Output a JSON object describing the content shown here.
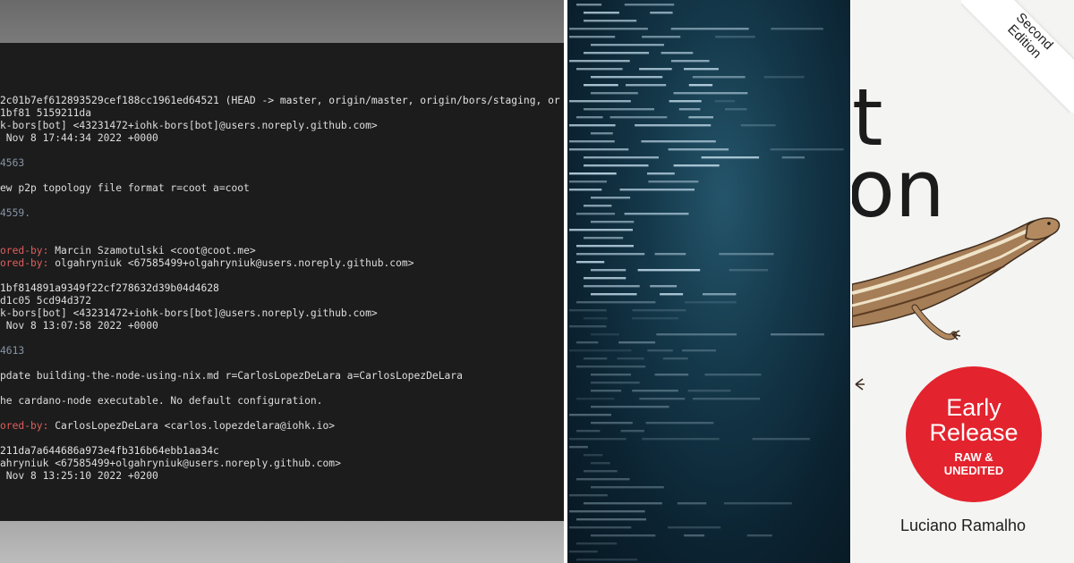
{
  "terminal": {
    "lines": [
      {
        "text": "2c01b7ef612893529cef188cc1961ed64521 (HEAD -> master, origin/master, origin/bors/staging, or",
        "style": "commit"
      },
      {
        "text": "1bf81 5159211da",
        "style": "normal"
      },
      {
        "text": "k-bors[bot] <43231472+iohk-bors[bot]@users.noreply.github.com>",
        "style": "normal"
      },
      {
        "text": " Nov 8 17:44:34 2022 +0000",
        "style": "normal"
      },
      {
        "text": "",
        "style": "normal"
      },
      {
        "text": "4563",
        "style": "dim"
      },
      {
        "text": "",
        "style": "normal"
      },
      {
        "text": "ew p2p topology file format r=coot a=coot",
        "style": "normal"
      },
      {
        "text": "",
        "style": "normal"
      },
      {
        "text": "4559.",
        "style": "dim"
      },
      {
        "text": "",
        "style": "normal"
      },
      {
        "text": "",
        "style": "normal"
      },
      {
        "text": "ored-by:",
        "style": "co",
        "rest": " Marcin Szamotulski <coot@coot.me>"
      },
      {
        "text": "ored-by:",
        "style": "co",
        "rest": " olgahryniuk <67585499+olgahryniuk@users.noreply.github.com>"
      },
      {
        "text": "",
        "style": "normal"
      },
      {
        "text": "1bf814891a9349f22cf278632d39b04d4628",
        "style": "commit"
      },
      {
        "text": "d1c05 5cd94d372",
        "style": "normal"
      },
      {
        "text": "k-bors[bot] <43231472+iohk-bors[bot]@users.noreply.github.com>",
        "style": "normal"
      },
      {
        "text": " Nov 8 13:07:58 2022 +0000",
        "style": "normal"
      },
      {
        "text": "",
        "style": "normal"
      },
      {
        "text": "4613",
        "style": "dim"
      },
      {
        "text": "",
        "style": "normal"
      },
      {
        "text": "pdate building-the-node-using-nix.md r=CarlosLopezDeLara a=CarlosLopezDeLara",
        "style": "normal"
      },
      {
        "text": "",
        "style": "normal"
      },
      {
        "text": "he cardano-node executable. No default configuration.",
        "style": "normal"
      },
      {
        "text": "",
        "style": "normal"
      },
      {
        "text": "ored-by:",
        "style": "co",
        "rest": " CarlosLopezDeLara <carlos.lopezdelara@iohk.io>"
      },
      {
        "text": "",
        "style": "normal"
      },
      {
        "text": "211da7a644686a973e4fb316b64ebb1aa34c",
        "style": "commit"
      },
      {
        "text": "ahryniuk <67585499+olgahryniuk@users.noreply.github.com>",
        "style": "normal"
      },
      {
        "text": " Nov 8 13:25:10 2022 +0200",
        "style": "normal"
      }
    ]
  },
  "book": {
    "title_fragment_1": "t",
    "title_fragment_2": "on",
    "edition": "Second Edition",
    "badge_line1": "Early",
    "badge_line2": "Release",
    "badge_sub1": "RAW &",
    "badge_sub2": "UNEDITED",
    "author": "Luciano Ramalho"
  },
  "colors": {
    "terminal_bg": "#1c1c1c",
    "code_bg": "#14384a",
    "badge_red": "#e3232e"
  }
}
